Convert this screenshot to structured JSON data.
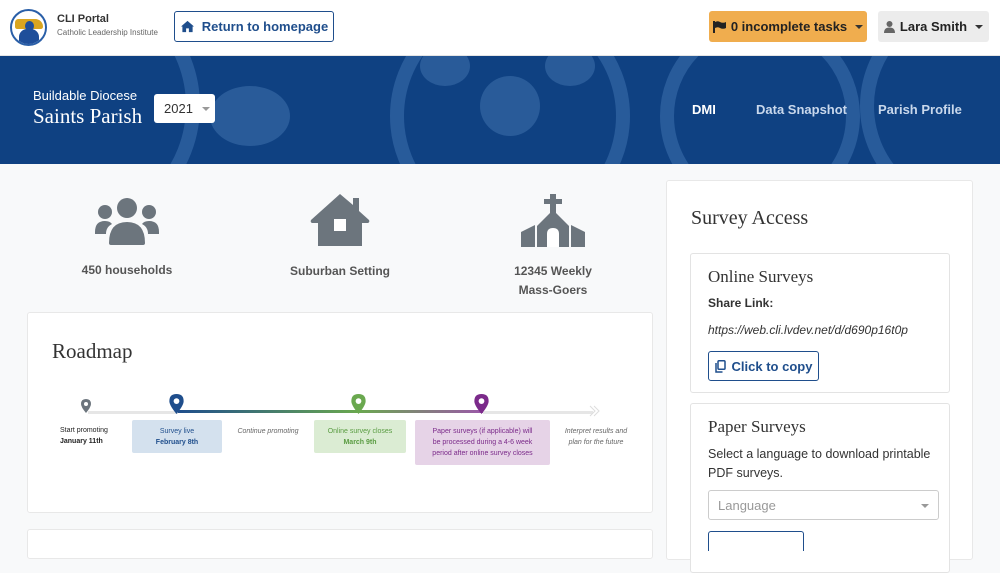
{
  "brand": {
    "title": "CLI Portal",
    "subtitle": "Catholic Leadership Institute"
  },
  "header": {
    "home_button": "Return to homepage",
    "tasks_button": "0 incomplete tasks",
    "user_button": "Lara Smith"
  },
  "hero": {
    "diocese": "Buildable Diocese",
    "parish": "Saints Parish",
    "year_selected": "2021",
    "nav": [
      {
        "label": "DMI",
        "active": true
      },
      {
        "label": "Data Snapshot",
        "active": false
      },
      {
        "label": "Parish Profile",
        "active": false
      }
    ]
  },
  "stats": [
    {
      "icon": "users-icon",
      "label": "450 households"
    },
    {
      "icon": "house-icon",
      "label": "Suburban Setting"
    },
    {
      "icon": "church-icon",
      "label_line1": "12345 Weekly",
      "label_line2": "Mass-Goers"
    }
  ],
  "roadmap": {
    "title": "Roadmap",
    "steps": [
      {
        "line1": "Start promoting",
        "line2": "January 11th",
        "color": "#6c757d"
      },
      {
        "line1": "Survey live",
        "line2": "February 8th",
        "color": "#1f4e8c"
      },
      {
        "line1": "Continue promoting"
      },
      {
        "line1": "Online survey closes",
        "line2": "March 9th",
        "color": "#6aa84f"
      },
      {
        "line1": "Paper surveys (if applicable) will",
        "line2": "be processed during a 4-6 week",
        "line3": "period after online survey closes",
        "color": "#7b2a8a"
      },
      {
        "line1": "Interpret results and",
        "line2": "plan for the future"
      }
    ]
  },
  "survey_access": {
    "title": "Survey Access",
    "online": {
      "title": "Online Surveys",
      "share_label": "Share Link:",
      "share_link": "https://web.cli.lvdev.net/d/d690p16t0p",
      "copy_button": "Click to copy"
    },
    "paper": {
      "title": "Paper Surveys",
      "description": "Select a language to download printable PDF surveys.",
      "language_placeholder": "Language"
    }
  },
  "colors": {
    "primary": "#1f4e8c",
    "warning": "#f0ad4e",
    "hero_bg": "#0f4182",
    "green": "#6aa84f",
    "purple": "#7b2a8a"
  }
}
